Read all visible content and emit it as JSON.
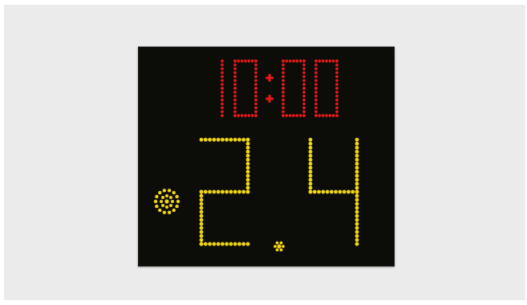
{
  "scoreboard": {
    "game_clock": "10:00",
    "shot_clock": "24",
    "clock_color": "#e8181a",
    "shot_color": "#f0d612",
    "board_color": "#0c0d09",
    "background_color": "#ebebeb",
    "indicator_icon": "possession-dot-icon"
  }
}
